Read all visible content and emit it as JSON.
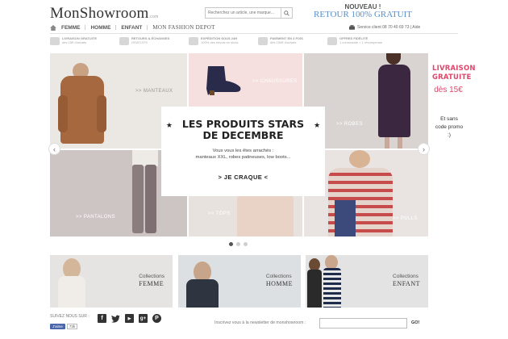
{
  "header": {
    "logo": "MonShowroom",
    "logo_suffix": ".com",
    "search_placeholder": "Recherchez un article, une marque...",
    "promo_line1": "NOUVEAU !",
    "promo_line2": "RETOUR 100% GRATUIT"
  },
  "nav": {
    "items": [
      "FEMME",
      "HOMME",
      "ENFANT",
      "MON FASHION DEPOT"
    ],
    "service": "Service client 08 70 40 69 73 | Aide"
  },
  "benefits": [
    {
      "title": "LIVRAISON GRATUITE",
      "sub": "dès 15€ d'achats"
    },
    {
      "title": "RETOURS & ÉCHANGES",
      "sub": "GRATUITS"
    },
    {
      "title": "EXPÉDITION SOUS 24H",
      "sub": "100% des envois en stock"
    },
    {
      "title": "PAIEMENT EN 3 FOIS",
      "sub": "dès 150€ d'achats"
    },
    {
      "title": "OFFRES FIDÉLITÉ",
      "sub": "1 commande = 1 récompense"
    }
  ],
  "hero": {
    "tiles": [
      "MANTEAUX",
      "CHAUSSURES",
      "ROBES",
      "PANTALONS",
      "TOPS",
      "PULLS"
    ],
    "tile_prefix": ">> ",
    "card_title_1": "LES PRODUITS STARS",
    "card_title_2": "DE DECEMBRE",
    "card_sub_1": "Vous vous les êtes arrachés :",
    "card_sub_2": "manteaux XXL, robes patineuses, low boots...",
    "card_button": "> JE CRAQUE <",
    "star": "★",
    "prev": "‹",
    "next": "›",
    "active_slide": 1
  },
  "side": {
    "livraison_1": "LIVRAISON",
    "livraison_2": "GRATUITE",
    "livraison_3": "dès 15€",
    "promo": "Et sans code promo :)"
  },
  "collections": [
    {
      "label": "Collections",
      "name": "FEMME"
    },
    {
      "label": "Collections",
      "name": "HOMME"
    },
    {
      "label": "Collections",
      "name": "ENFANT"
    }
  ],
  "footer": {
    "follow": "SUIVEZ NOUS SUR :",
    "social_icons": [
      "facebook-icon",
      "twitter-icon",
      "youtube-icon",
      "google-icon",
      "pinterest-icon"
    ],
    "fb_like": "J'aime",
    "fb_count": "73k",
    "newsletter": "Inscrivez vous à la newsletter de monshowroom :",
    "go": "GO!"
  },
  "colors": {
    "accent_pink": "#e0476c",
    "accent_blue": "#5a8fc8",
    "facebook": "#4a67ad"
  }
}
